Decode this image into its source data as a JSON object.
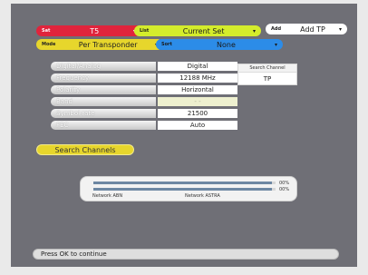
{
  "header": {
    "satellite": {
      "key": "Sat",
      "value": "T5"
    },
    "list": {
      "key": "List",
      "value": "Current Set"
    },
    "add_tp": {
      "key": "Add",
      "value": "Add TP"
    },
    "mode": {
      "key": "Mode",
      "value": "Per Transponder"
    },
    "sort": {
      "key": "Sort",
      "value": "None"
    }
  },
  "fields": [
    {
      "label": "Digital/Analog",
      "value": "Digital"
    },
    {
      "label": "Frequency",
      "value": "12188 MHz"
    },
    {
      "label": "Polarity",
      "value": "Horizontal"
    },
    {
      "label": "Band",
      "value": "- -"
    },
    {
      "label": "Symbol rate",
      "value": "21500"
    },
    {
      "label": "FEC",
      "value": "Auto"
    }
  ],
  "search_channel_box": {
    "title": "Search Channel",
    "value": "TP"
  },
  "search_button": "Search Channels",
  "signal": {
    "strength_pct": "00%",
    "quality_pct": "00%",
    "strength_fill": 0.98,
    "quality_fill": 0.98,
    "left_caption": "Network ABN",
    "right_caption": "Network ASTRA"
  },
  "footer": {
    "message": "Press OK to continue"
  },
  "colors": {
    "red": "#e0243c",
    "green": "#d4ec2c",
    "yellow": "#e7d62c",
    "blue": "#2c8ce8",
    "screen": "#6f6f76"
  }
}
